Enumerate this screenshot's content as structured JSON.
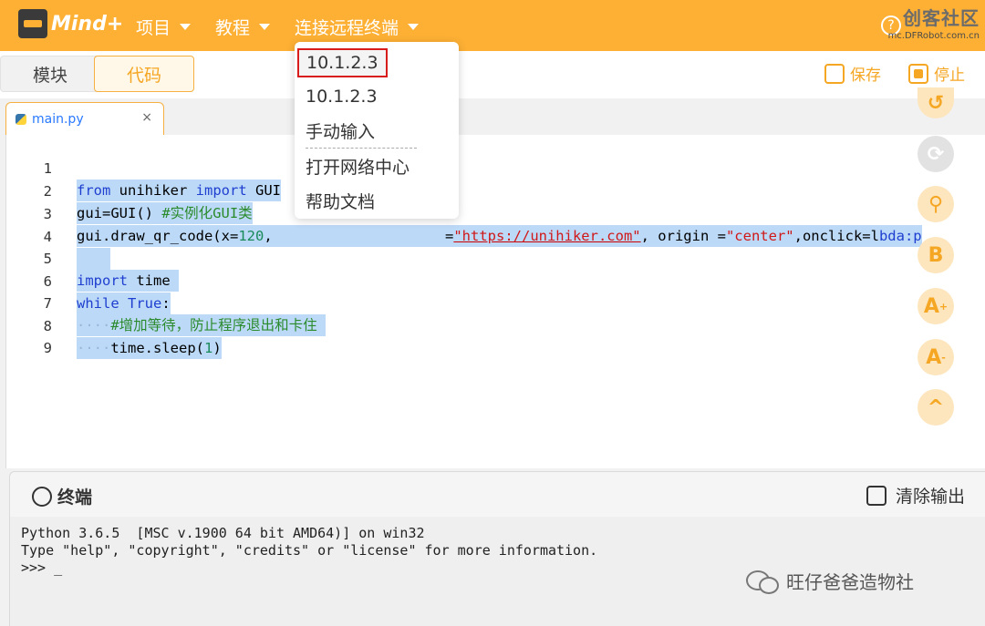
{
  "app": {
    "logo_text": "Mind+"
  },
  "menubar": {
    "items": [
      {
        "label": "项目"
      },
      {
        "label": "教程"
      },
      {
        "label": "连接远程终端"
      }
    ],
    "brand_title": "创客社区",
    "brand_url": "mc.DFRobot.com.cn"
  },
  "toolbar": {
    "tab_module": "模块",
    "tab_code": "代码",
    "save_label": "保存",
    "stop_label": "停止"
  },
  "editor": {
    "file_tab": "main.py",
    "close_glyph": "×",
    "line_numbers": [
      "1",
      "2",
      "3",
      "4",
      "5",
      "6",
      "7",
      "8",
      "9"
    ],
    "lines": {
      "l1_kw1": "from",
      "l1_mod": " unihiker ",
      "l1_kw2": "import",
      "l1_rest": " GUI",
      "l2_code": "gui=GUI() ",
      "l2_cm": "#实例化GUI类",
      "l3_a": "gui.draw_qr_code(x=",
      "l3_n": "120",
      "l3_b": ", ",
      "l3_c": "=",
      "l3_str": "\"https://unihiker.com\"",
      "l3_d": ", origin =",
      "l3_str2": "\"center\"",
      "l3_e": ",onclick=l",
      "l3_f": "bda:p",
      "l5_kw": "import",
      "l5_rest": " time",
      "l6_kw1": "while",
      "l6_kw2": "True",
      "l6_colon": ":",
      "l7_ws": "····",
      "l7_cm": "#增加等待，防止程序退出和卡住",
      "l8_ws": "····",
      "l8_code": "time.sleep(",
      "l8_n": "1",
      "l8_end": ")"
    }
  },
  "dropdown": {
    "items": [
      "10.1.2.3",
      "10.1.2.3",
      "手动输入",
      "打开网络中心",
      "帮助文档"
    ]
  },
  "side_buttons": [
    "B",
    "A",
    "A",
    "^"
  ],
  "terminal": {
    "title": "终端",
    "clear_label": "清除输出",
    "lines": [
      "Python 3.6.5  [MSC v.1900 64 bit AMD64)] on win32",
      "Type \"help\", \"copyright\", \"credits\" or \"license\" for more information.",
      ">>> _"
    ],
    "watermark": "旺仔爸爸造物社"
  },
  "colors": {
    "accent": "#fdb034",
    "selection": "#bcdaf8",
    "highlight_border": "#d81b1b"
  }
}
